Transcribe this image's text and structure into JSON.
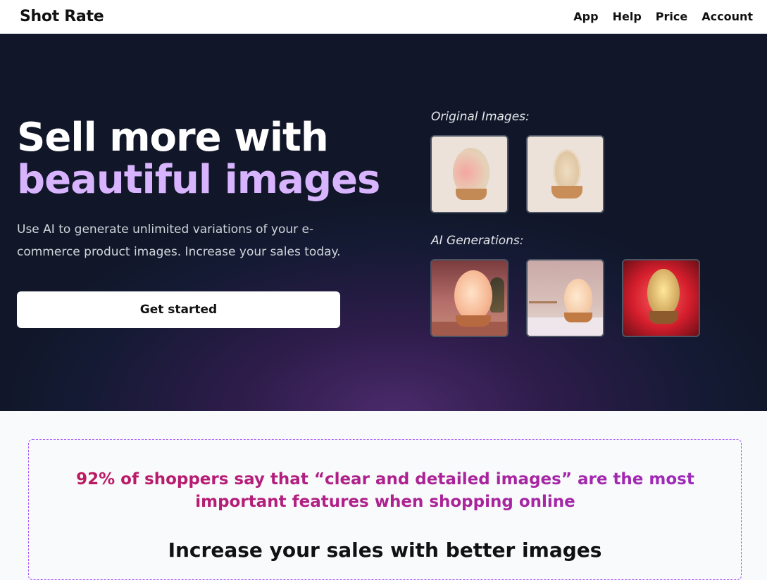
{
  "nav": {
    "brand": "Shot Rate",
    "links": [
      "App",
      "Help",
      "Price",
      "Account"
    ]
  },
  "hero": {
    "headline_line1": "Sell more with",
    "headline_line2": "beautiful images",
    "subtitle": "Use AI to generate unlimited variations of your e-commerce product images. Increase your sales today.",
    "cta": "Get started",
    "original_label": "Original Images:",
    "generations_label": "AI Generations:"
  },
  "stats": {
    "quote": "92% of shoppers say that “clear and detailed images” are the most important features when shopping online",
    "next_heading": "Increase your sales with better images"
  },
  "colors": {
    "hero_bg": "#111729",
    "accent": "#d8b4fe",
    "quote_start": "#be185d",
    "quote_end": "#9d2bbf"
  }
}
